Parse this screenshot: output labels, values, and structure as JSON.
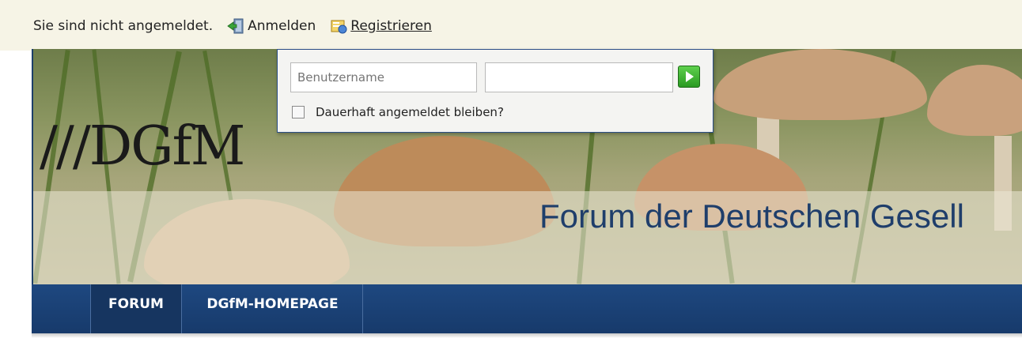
{
  "topbar": {
    "status_text": "Sie sind nicht angemeldet.",
    "login_label": "Anmelden",
    "register_label": "Registrieren"
  },
  "banner": {
    "logo_text": "///DGfM",
    "title": "Forum der Deutschen Gesell"
  },
  "login_form": {
    "username_placeholder": "Benutzername",
    "password_value": "",
    "remember_label": "Dauerhaft angemeldet bleiben?",
    "remember_checked": false
  },
  "nav": {
    "items": [
      {
        "label": "FORUM"
      },
      {
        "label": "DGfM-HOMEPAGE"
      }
    ]
  },
  "colors": {
    "nav_bg": "#1e4880",
    "title_color": "#1f3e6b",
    "topbar_bg": "#f6f4e6",
    "go_button": "#3cb531"
  }
}
